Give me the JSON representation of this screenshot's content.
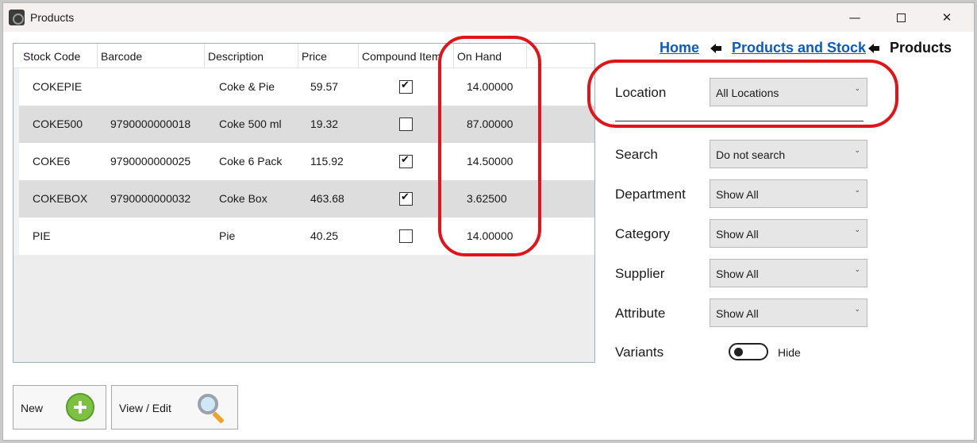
{
  "window": {
    "title": "Products",
    "minimize_glyph": "—",
    "close_glyph": "✕"
  },
  "table": {
    "columns": [
      "Stock Code",
      "Barcode",
      "Description",
      "Price",
      "Compound Item",
      "On Hand"
    ],
    "rows": [
      {
        "stock_code": "COKEPIE",
        "barcode": "",
        "description": "Coke & Pie",
        "price": "59.57",
        "compound": true,
        "on_hand": "14.00000"
      },
      {
        "stock_code": "COKE500",
        "barcode": "9790000000018",
        "description": "Coke 500 ml",
        "price": "19.32",
        "compound": false,
        "on_hand": "87.00000"
      },
      {
        "stock_code": "COKE6",
        "barcode": "9790000000025",
        "description": "Coke 6 Pack",
        "price": "115.92",
        "compound": true,
        "on_hand": "14.50000"
      },
      {
        "stock_code": "COKEBOX",
        "barcode": "9790000000032",
        "description": "Coke Box",
        "price": "463.68",
        "compound": true,
        "on_hand": "3.62500"
      },
      {
        "stock_code": "PIE",
        "barcode": "",
        "description": "Pie",
        "price": "40.25",
        "compound": false,
        "on_hand": "14.00000"
      }
    ]
  },
  "breadcrumb": {
    "home": "Home",
    "products_and_stock": "Products and Stock",
    "current": "Products"
  },
  "filters": {
    "location": {
      "label": "Location",
      "value": "All Locations"
    },
    "search": {
      "label": "Search",
      "value": "Do not search"
    },
    "department": {
      "label": "Department",
      "value": "Show All"
    },
    "category": {
      "label": "Category",
      "value": "Show All"
    },
    "supplier": {
      "label": "Supplier",
      "value": "Show All"
    },
    "attribute": {
      "label": "Attribute",
      "value": "Show All"
    },
    "variants": {
      "label": "Variants",
      "toggle_text": "Hide",
      "on": false
    }
  },
  "buttons": {
    "new": "New",
    "view_edit": "View / Edit"
  },
  "colors": {
    "link": "#0b5cc2",
    "annotation": "#e0141a",
    "alt_row": "#dddddd",
    "add_icon": "#7dc142"
  },
  "icons": {
    "app": "app-logo-icon",
    "new": "plus-circle-icon",
    "view_edit": "magnifier-icon",
    "breadcrumb_separator": "arrow-left-icon",
    "dropdown": "chevron-down-icon"
  }
}
